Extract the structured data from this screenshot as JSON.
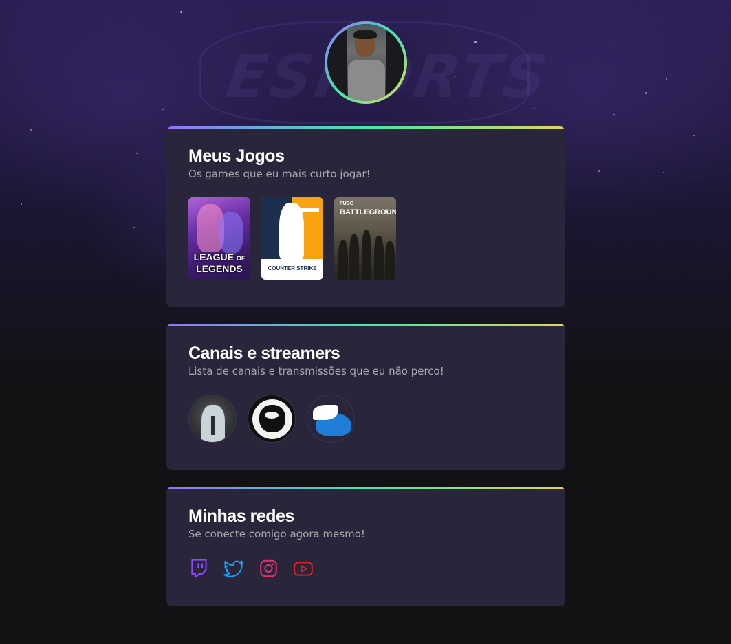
{
  "background": {
    "watermark_text": "ESPORTS"
  },
  "profile": {
    "avatar_icon": "profile-avatar",
    "gradient": [
      "#9572fc",
      "#43e7ad",
      "#e2d45c"
    ]
  },
  "games_card": {
    "title": "Meus Jogos",
    "subtitle": "Os games que eu mais curto jogar!",
    "games": [
      {
        "name": "League of Legends",
        "logo_line1": "LEAGUE",
        "logo_line2": "OF",
        "logo_line3": "LEGENDS"
      },
      {
        "name": "Counter-Strike",
        "logo": "COUNTER STRIKE"
      },
      {
        "name": "PUBG Battlegrounds",
        "logo_small": "PUBG",
        "logo": "BATTLEGROUNDS"
      }
    ]
  },
  "streamers_card": {
    "title": "Canais e streamers",
    "subtitle": "Lista de canais e transmissões que eu não perco!",
    "streamers": [
      {
        "icon": "suit-man-avatar"
      },
      {
        "icon": "cartoon-face-avatar"
      },
      {
        "icon": "winged-cap-avatar"
      }
    ]
  },
  "social_card": {
    "title": "Minhas redes",
    "subtitle": "Se conecte comigo agora mesmo!",
    "links": [
      {
        "icon": "twitch-icon",
        "color": "#9146ff"
      },
      {
        "icon": "twitter-icon",
        "color": "#1d9bf0"
      },
      {
        "icon": "instagram-icon",
        "color": "#e1306c"
      },
      {
        "icon": "youtube-icon",
        "color": "#e02424"
      }
    ]
  },
  "colors": {
    "page_bg": "#121214",
    "card_bg": "#29253a",
    "title": "#ffffff",
    "subtitle": "#a8a8b3"
  }
}
